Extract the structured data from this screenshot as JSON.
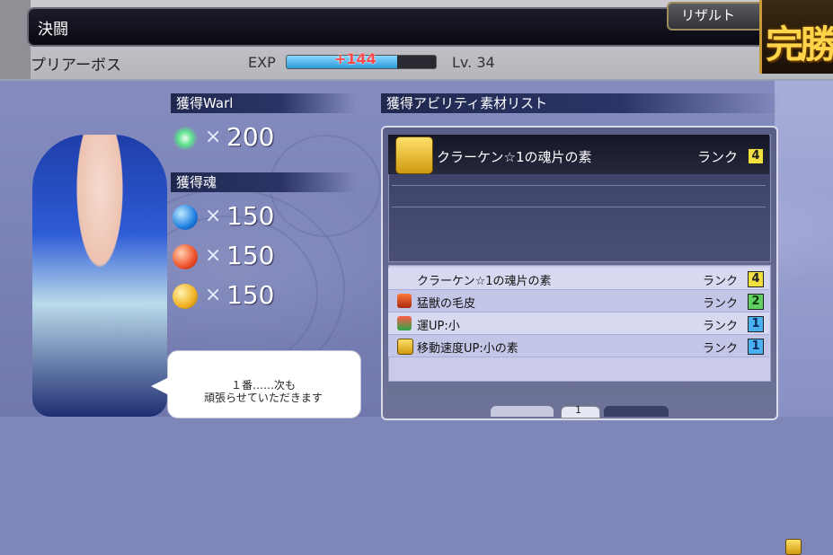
{
  "header": {
    "battle_title": "決闘",
    "boss_name": "プリアーボス",
    "exp_label": "EXP",
    "exp_gain": "+144",
    "exp_fill": 0.74,
    "level": "Lv. 34",
    "result_label": "リザルト",
    "victory": "完勝"
  },
  "rewards": {
    "warl_header": "獲得Warl",
    "warl": {
      "icon": "warl-crystal-icon",
      "x": "×",
      "value": "200"
    },
    "souls_header": "獲得魂",
    "souls": [
      {
        "icon": "blue-soul-icon",
        "color": "#1f7fe0",
        "x": "×",
        "value": "150"
      },
      {
        "icon": "red-soul-icon",
        "color": "#f0502a",
        "x": "×",
        "value": "150"
      },
      {
        "icon": "yellow-soul-icon",
        "color": "#f0b020",
        "x": "×",
        "value": "150"
      }
    ]
  },
  "speech": {
    "text": "１番……次も\n頑張らせていただきます"
  },
  "materials": {
    "header": "獲得アビリティ素材リスト",
    "selected": {
      "icon": "scroll-icon",
      "name": "クラーケン☆1の魂片の素",
      "rank_label": "ランク",
      "rank": "4"
    },
    "items": [
      {
        "icon": "scroll-icon",
        "name": "クラーケン☆1の魂片の素",
        "rank_label": "ランク",
        "rank": "4"
      },
      {
        "icon": "fur-icon",
        "name": "猛獣の毛皮",
        "rank_label": "ランク",
        "rank": "2"
      },
      {
        "icon": "luck-up-icon",
        "name": "運UP:小",
        "rank_label": "ランク",
        "rank": "1"
      },
      {
        "icon": "scroll-icon",
        "name": "移動速度UP:小の素",
        "rank_label": "ランク",
        "rank": "1"
      }
    ],
    "page": "1"
  }
}
